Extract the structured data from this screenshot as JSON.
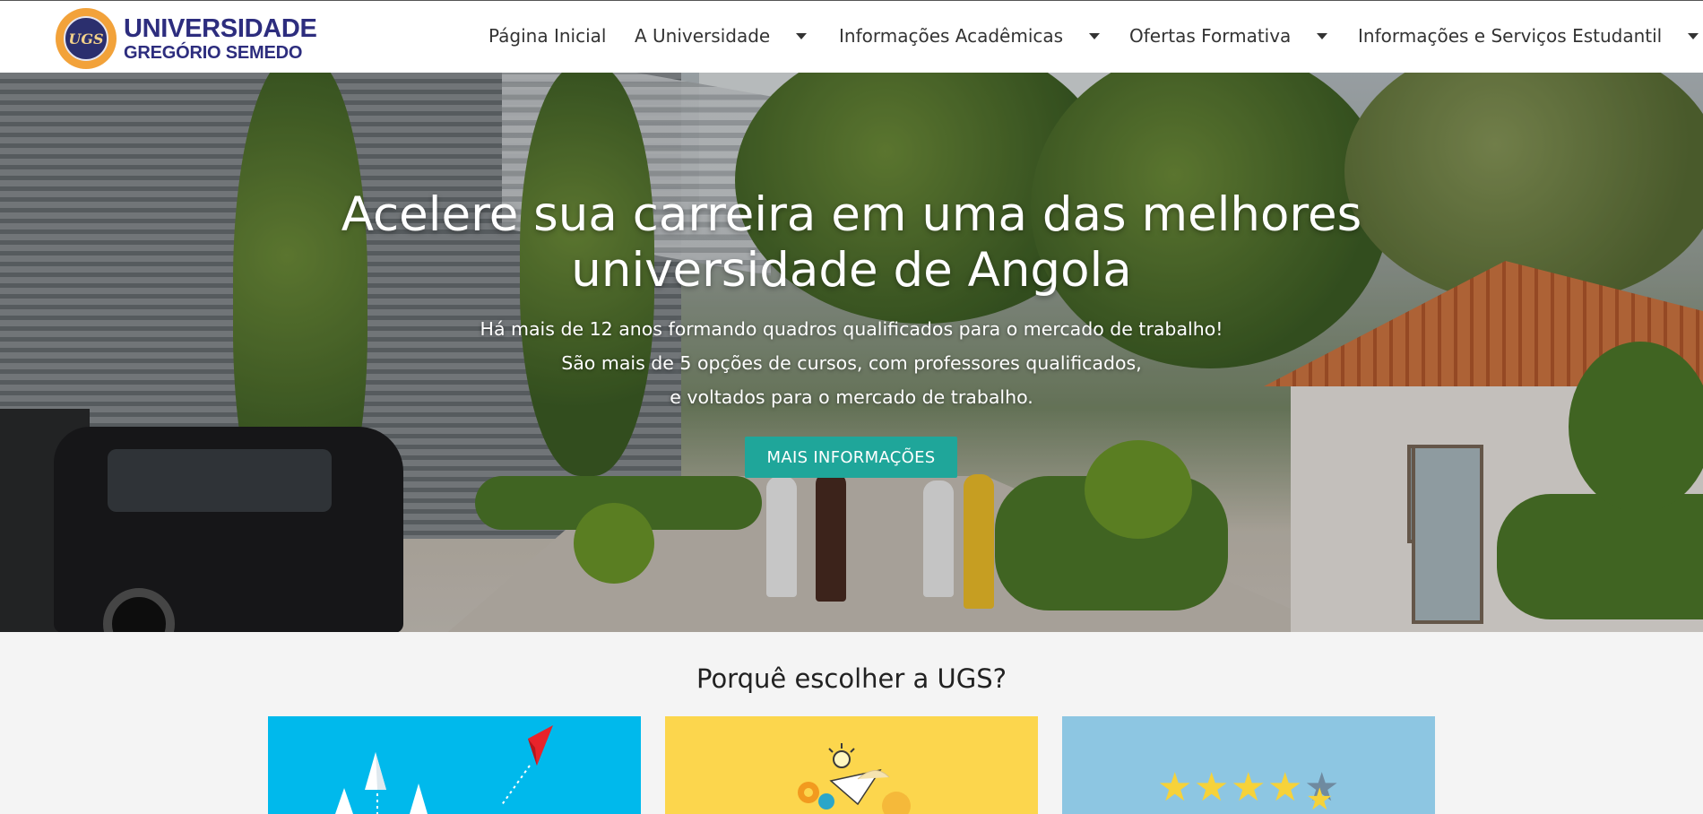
{
  "header": {
    "logo": {
      "line1": "UNIVERSIDADE",
      "line2": "GREGÓRIO SEMEDO",
      "seal_letters": "UGS"
    },
    "nav": [
      {
        "label": "Página Inicial",
        "has_dropdown": false
      },
      {
        "label": "A Universidade",
        "has_dropdown": true
      },
      {
        "label": "Informações Acadêmicas",
        "has_dropdown": true
      },
      {
        "label": "Ofertas Formativa",
        "has_dropdown": true
      },
      {
        "label": "Informações e Serviços Estudantil",
        "has_dropdown": true
      }
    ]
  },
  "hero": {
    "title_line1": "Acelere sua carreira em uma das melhores",
    "title_line2": "universidade de Angola",
    "subtitle_line1": "Há mais de 12 anos formando quadros qualificados para o mercado de trabalho!",
    "subtitle_line2": "São mais de 5 opções de cursos, com professores qualificados,",
    "subtitle_line3": "e voltados para o mercado de trabalho.",
    "button_label": "MAIS INFORMAÇÕES",
    "button_color": "#1fa69a"
  },
  "why": {
    "title": "Porquê escolher a UGS?",
    "cards": [
      {
        "icon": "paper-planes-icon",
        "color": "#00b9ec"
      },
      {
        "icon": "idea-gears-icon",
        "color": "#fcd64d"
      },
      {
        "icon": "rating-stars-icon",
        "color": "#8dc6e2"
      }
    ]
  },
  "colors": {
    "brand": "#2d2d7e",
    "accent": "#1fa69a"
  }
}
